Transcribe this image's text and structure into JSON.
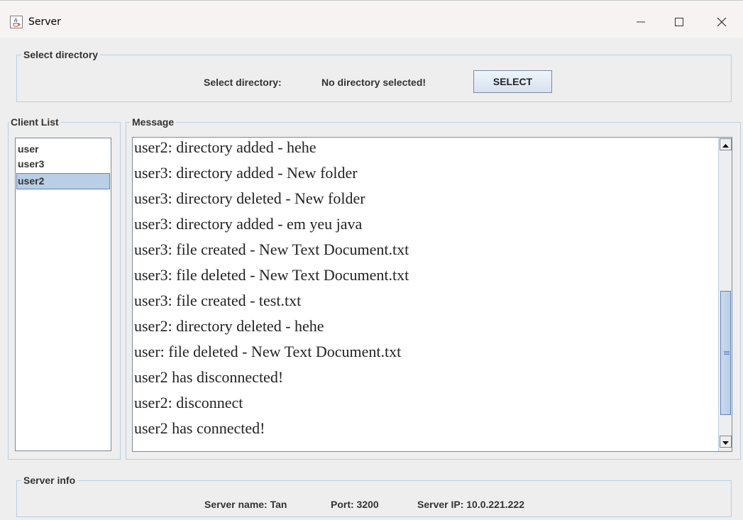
{
  "window": {
    "title": "Server",
    "icons": {
      "app": "java-cup-icon",
      "minimize": "minimize-icon",
      "maximize": "maximize-icon",
      "close": "close-icon"
    }
  },
  "select_directory": {
    "group_title": "Select directory",
    "label": "Select directory:",
    "status": "No directory selected!",
    "button": "SELECT"
  },
  "client_list": {
    "group_title": "Client List",
    "items": [
      "user",
      "user3",
      "user2"
    ],
    "selected": "user2"
  },
  "message": {
    "group_title": "Message",
    "lines": [
      "user2: directory added - hehe",
      "user3: directory added - New folder",
      "user3: directory deleted - New folder",
      "user3: directory added - em yeu java",
      "user3: file created - New Text Document.txt",
      "user3: file deleted - New Text Document.txt",
      "user3: file created - test.txt",
      "user2: directory deleted - hehe",
      "user: file deleted - New Text Document.txt",
      "user2 has disconnected!",
      "user2: disconnect",
      "user2 has connected!"
    ],
    "scroll_position": 0.95
  },
  "server_info": {
    "group_title": "Server info",
    "name": "Server name: Tan",
    "port": "Port: 3200",
    "ip": "Server IP: 10.0.221.222"
  },
  "colors": {
    "selection": "#b8cfe5",
    "selection_border": "#6382bf",
    "border": "#7a8a99",
    "background": "#eeeeee"
  }
}
